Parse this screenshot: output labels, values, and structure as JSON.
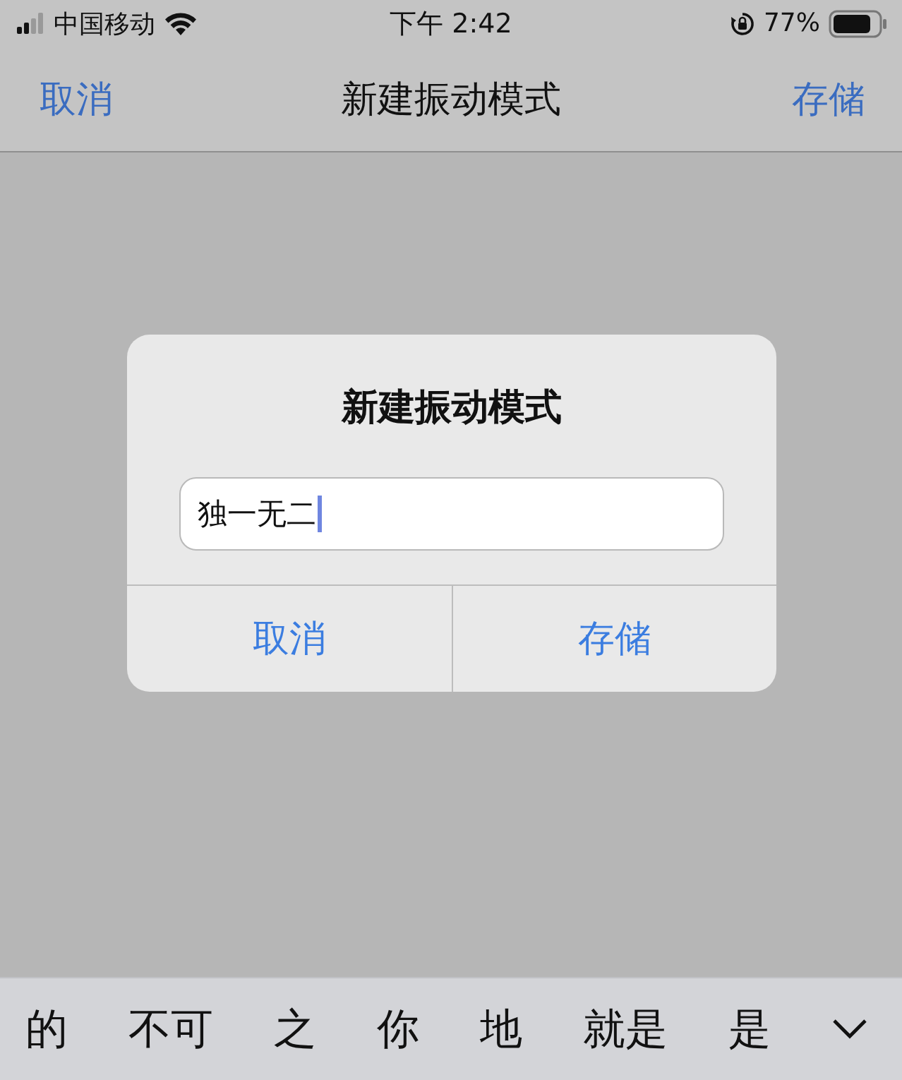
{
  "status_bar": {
    "carrier": "中国移动",
    "time": "下午 2:42",
    "battery": "77%"
  },
  "nav_bar": {
    "cancel": "取消",
    "title": "新建振动模式",
    "save": "存储"
  },
  "dialog": {
    "title": "新建振动模式",
    "field": {
      "value": "独一无二"
    },
    "buttons": [
      "取消",
      "存储"
    ]
  },
  "candidates": [
    "的",
    "不可",
    "之",
    "你",
    "地",
    "就是",
    "是"
  ]
}
